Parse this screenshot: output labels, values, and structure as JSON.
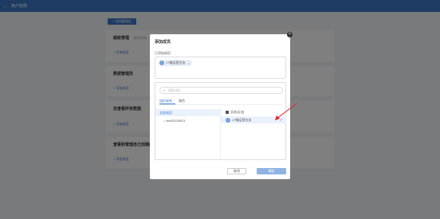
{
  "topbar": {
    "back_icon": "arrow-left-icon",
    "title": "用户权限"
  },
  "page": {
    "add_role_label": "+ 添加管理员",
    "sections": [
      {
        "title": "超级管理",
        "sub": "拥有所有",
        "link": "+ 添加成员"
      },
      {
        "title": "数据管理员",
        "sub": "",
        "link": "+ 添加成员"
      },
      {
        "title": "仅查看所有数据",
        "sub": "",
        "link": "+ 添加成员"
      },
      {
        "title": "查看和管理自己创建的数据",
        "sub": "",
        "link": "+ 添加成员"
      }
    ]
  },
  "modal": {
    "title": "添加成员",
    "close_icon": "close-icon",
    "selected_label": "已添加成员",
    "selected_chip": {
      "name": "17幢运营业务",
      "remove": "×"
    },
    "search_placeholder": "搜索成员",
    "search_icon": "search-icon",
    "tabs": [
      {
        "label": "组织架构",
        "active": true
      },
      {
        "label": "角色",
        "active": false
      }
    ],
    "tree_all": "全部成员",
    "tree_item": "test20230521",
    "check_all": "全选/反选",
    "member": {
      "name": "17幢运营业务",
      "tick": "✓"
    },
    "cancel_label": "取消",
    "ok_label": "确定"
  },
  "colors": {
    "accent": "#3d78c7",
    "overlay": "rgba(0,0,0,0.5)",
    "annotation_arrow": "#e02020"
  }
}
